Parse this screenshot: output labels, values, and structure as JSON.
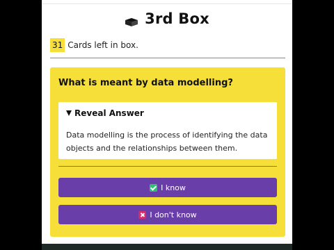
{
  "header": {
    "title": "3rd Box",
    "icon": "box-icon"
  },
  "status": {
    "cards_left": "31",
    "cards_left_label": "Cards left in box."
  },
  "card": {
    "question": "What is meant by data modelling?",
    "reveal_label": "Reveal Answer",
    "answer": "Data modelling is the process of identifying the data objects and the relationships between them."
  },
  "actions": {
    "know_label": "I know",
    "dont_know_label": "I don't know"
  },
  "colors": {
    "card_bg": "#f7df3a",
    "button_bg": "#6a3ea8",
    "know_icon": "#2fbf71",
    "dont_know_icon": "#d62c6d"
  }
}
